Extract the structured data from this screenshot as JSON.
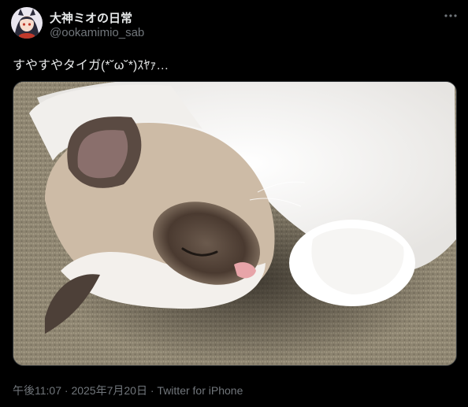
{
  "author": {
    "display_name": "大神ミオの日常",
    "handle": "@ookamimio_sab",
    "avatar_icon": "character-avatar-icon"
  },
  "menu": {
    "icon": "more-horizontal-icon"
  },
  "tweet": {
    "text": "すやすやタイガ(*˘ω˘*)ｽﾔｧ…",
    "image_subject": "sleeping ragdoll cat on carpet"
  },
  "meta": {
    "time": "午後11:07",
    "separator1": " · ",
    "date": "2025年7月20日",
    "separator2": " · ",
    "client": "Twitter for iPhone"
  },
  "colors": {
    "background": "#000000",
    "text_primary": "#e7e9ea",
    "text_secondary": "#71767b",
    "border": "#2f3336"
  }
}
